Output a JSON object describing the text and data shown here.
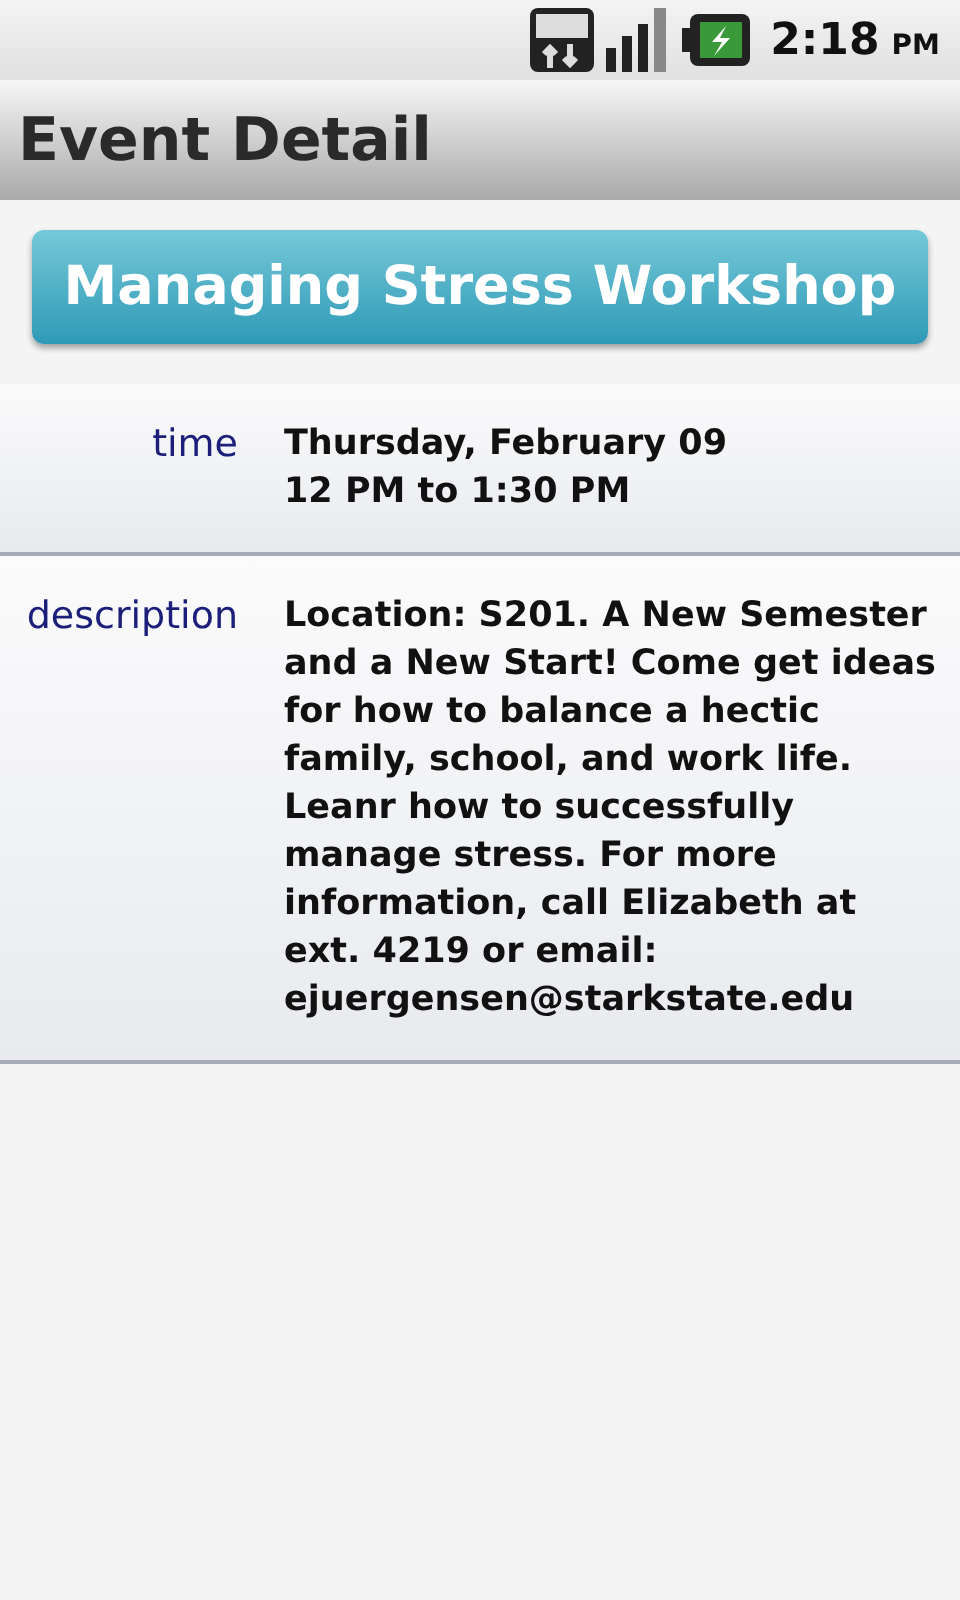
{
  "status_bar": {
    "time": "2:18",
    "period": "PM"
  },
  "title": "Event Detail",
  "event_button": "Managing Stress Workshop",
  "fields": [
    {
      "label": "time",
      "value": "Thursday, February 09\n12 PM to 1:30 PM"
    },
    {
      "label": "description",
      "value": "Location: S201. A New Semester and a New Start! Come get ideas for how to balance a hectic family, school, and work life. Leanr how to successfully manage stress. For more information, call Elizabeth at ext. 4219 or email: ejuergensen@starkstate.edu"
    }
  ]
}
